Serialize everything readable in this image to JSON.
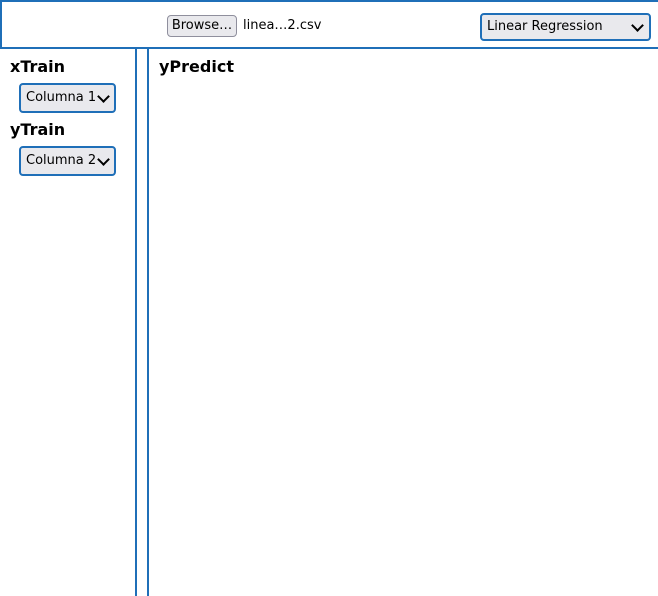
{
  "header": {
    "browse_label": "Browse…",
    "file_name": "linea…2.csv",
    "model_select": "Linear Regression"
  },
  "sidebar": {
    "x_label": "xTrain",
    "x_select": "Columna 1",
    "y_label": "yTrain",
    "y_select": "Columna 2"
  },
  "main": {
    "title": "yPredict"
  },
  "colors": {
    "accent": "#1f6fb8",
    "control_bg": "#e9e9ed"
  }
}
